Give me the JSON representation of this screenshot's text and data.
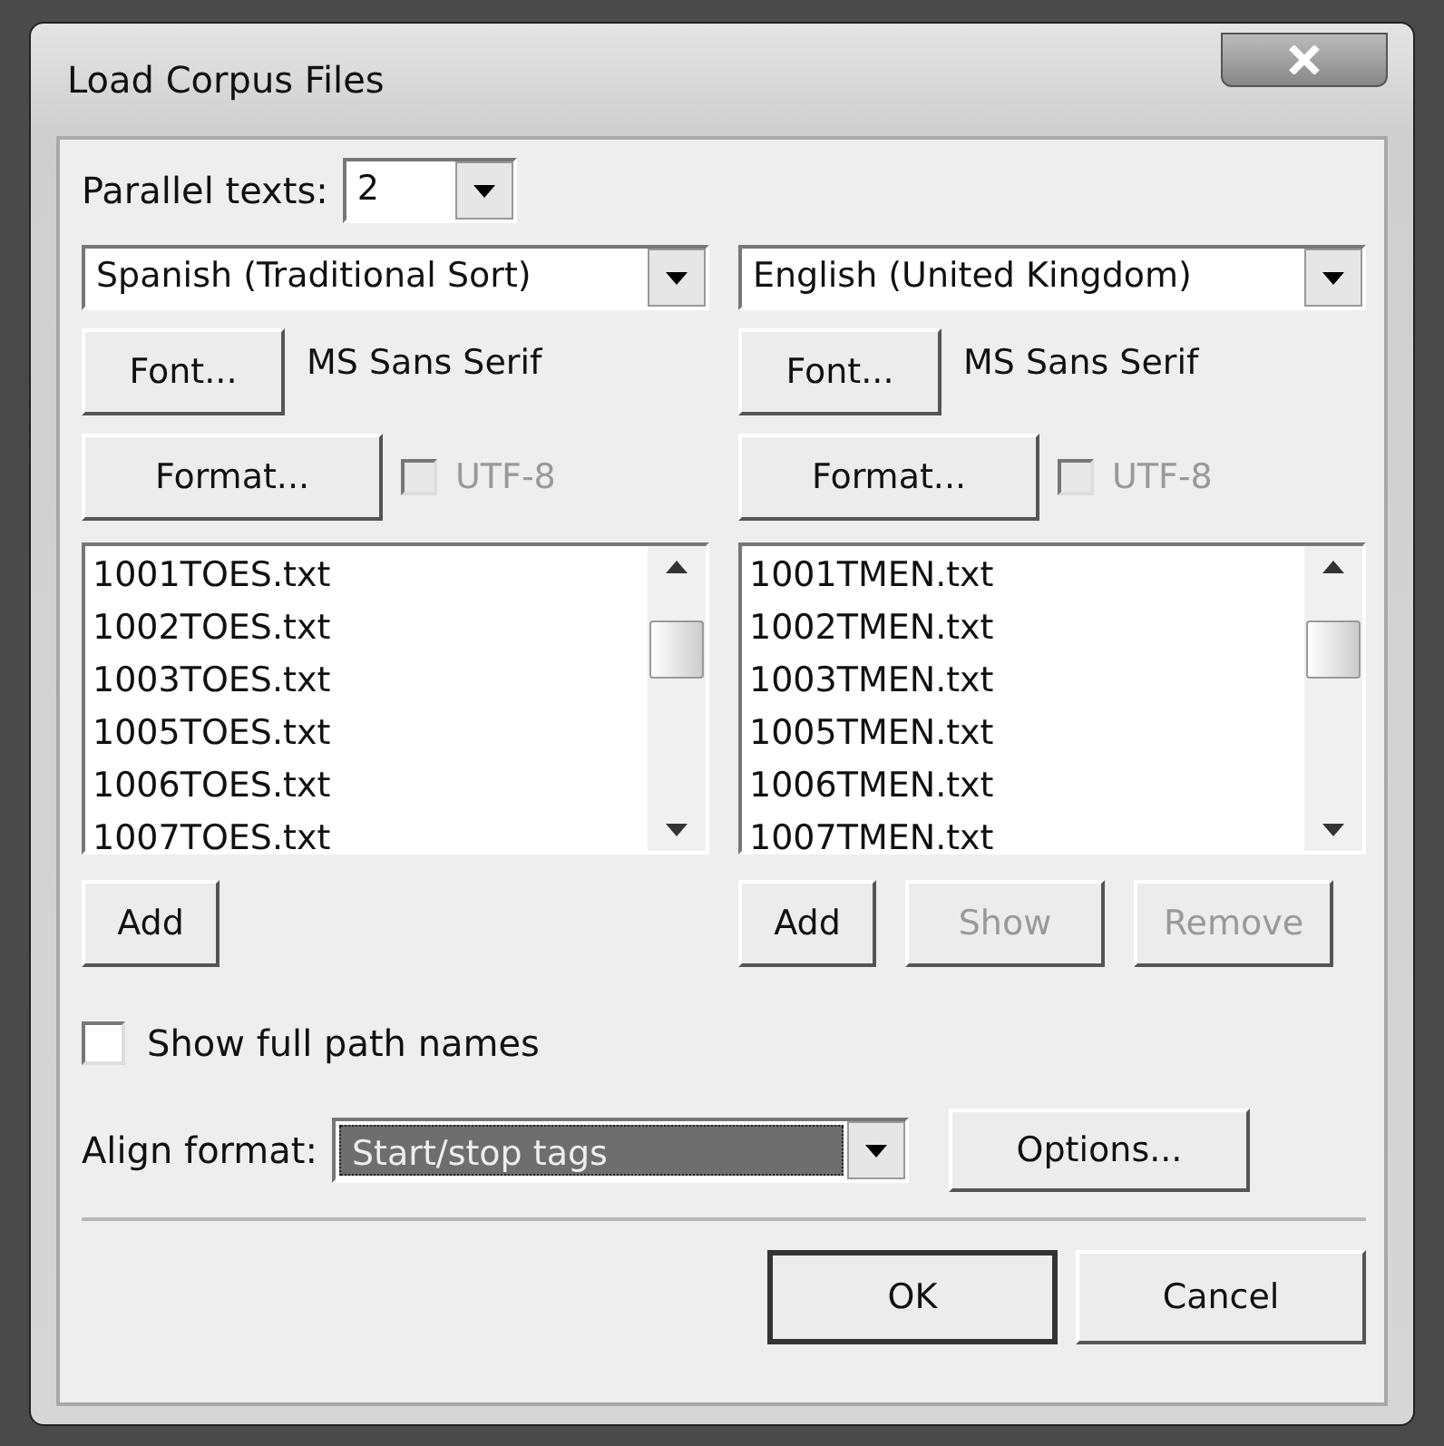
{
  "window": {
    "title": "Load Corpus Files"
  },
  "parallel_texts": {
    "label": "Parallel texts:",
    "value": "2"
  },
  "panes": [
    {
      "language": "Spanish (Traditional Sort)",
      "font_button": "Font...",
      "font_name": "MS Sans Serif",
      "format_button": "Format...",
      "utf8": {
        "label": "UTF-8",
        "checked": false,
        "disabled": true
      },
      "files": [
        "1001TOES.txt",
        "1002TOES.txt",
        "1003TOES.txt",
        "1005TOES.txt",
        "1006TOES.txt",
        "1007TOES.txt"
      ],
      "buttons": [
        {
          "label": "Add",
          "disabled": false
        }
      ]
    },
    {
      "language": "English (United Kingdom)",
      "font_button": "Font...",
      "font_name": "MS Sans Serif",
      "format_button": "Format...",
      "utf8": {
        "label": "UTF-8",
        "checked": false,
        "disabled": true
      },
      "files": [
        "1001TMEN.txt",
        "1002TMEN.txt",
        "1003TMEN.txt",
        "1005TMEN.txt",
        "1006TMEN.txt",
        "1007TMEN.txt"
      ],
      "buttons": [
        {
          "label": "Add",
          "disabled": false
        },
        {
          "label": "Show",
          "disabled": true
        },
        {
          "label": "Remove",
          "disabled": true
        }
      ]
    }
  ],
  "show_full_path": {
    "label": "Show full path names",
    "checked": false
  },
  "align_format": {
    "label": "Align format:",
    "value": "Start/stop tags",
    "highlighted": true,
    "options_button": "Options..."
  },
  "buttons": [
    "OK",
    "Cancel"
  ]
}
